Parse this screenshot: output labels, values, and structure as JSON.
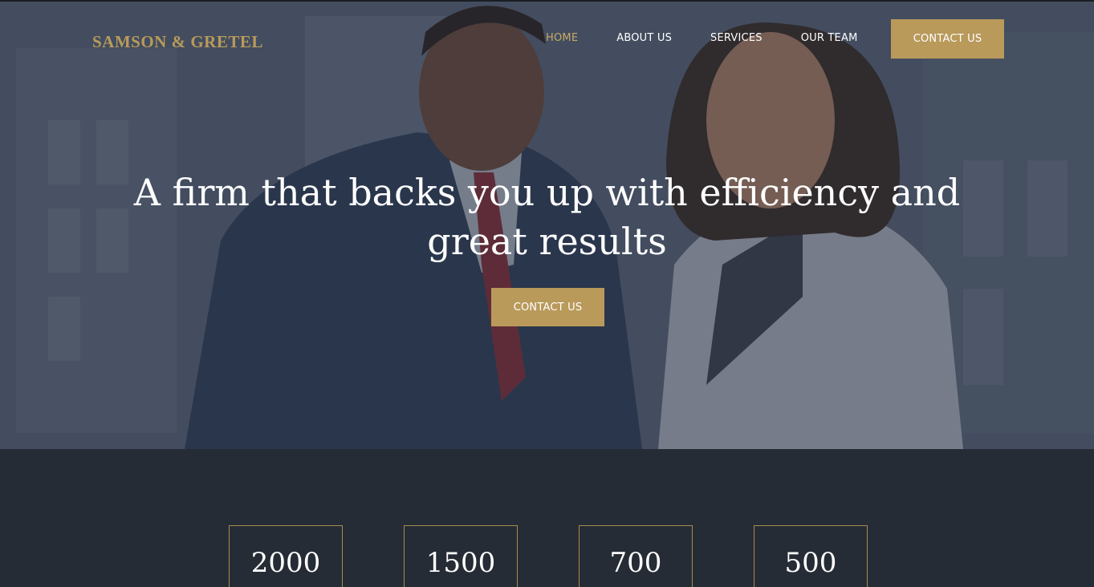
{
  "brand": {
    "logo_text": "SAMSON & GRETEL",
    "accent_color": "#b99a5b"
  },
  "nav": {
    "items": [
      {
        "label": "HOME",
        "active": true
      },
      {
        "label": "ABOUT US",
        "active": false
      },
      {
        "label": "SERVICES",
        "active": false
      },
      {
        "label": "OUR TEAM",
        "active": false
      }
    ],
    "cta_label": "CONTACT US"
  },
  "hero": {
    "headline": "A firm that backs you up with efficiency and great results",
    "cta_label": "CONTACT US",
    "image": "business-man-and-woman-smiling-photo"
  },
  "stats": {
    "items": [
      {
        "value": "2000"
      },
      {
        "value": "1500"
      },
      {
        "value": "700"
      },
      {
        "value": "500"
      }
    ]
  }
}
